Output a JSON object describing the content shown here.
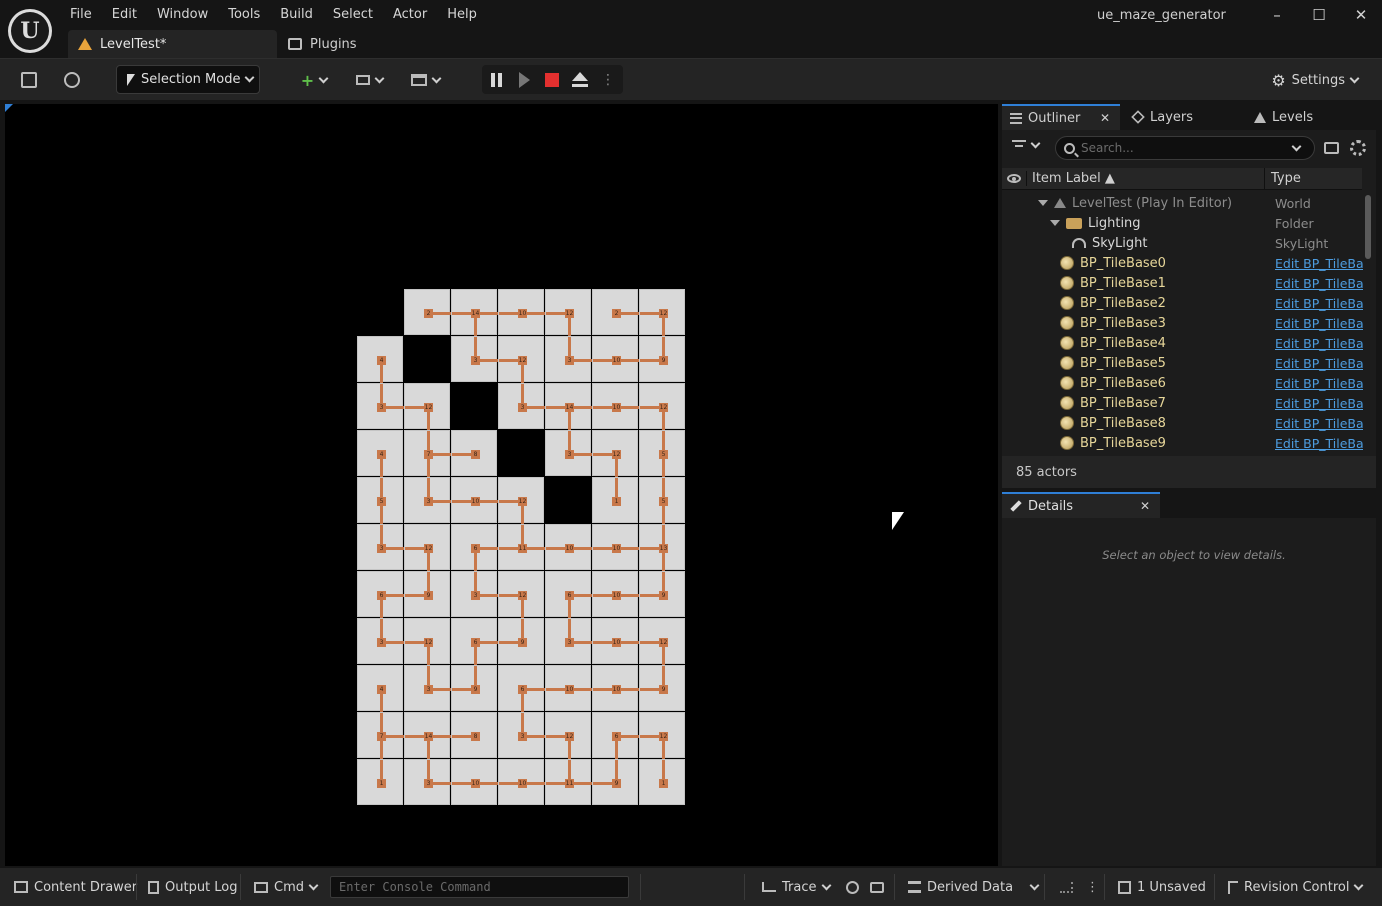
{
  "menu": [
    "File",
    "Edit",
    "Window",
    "Tools",
    "Build",
    "Select",
    "Actor",
    "Help"
  ],
  "app_title": "ue_maze_generator",
  "window_controls": {
    "minimize": "–",
    "maximize": "☐",
    "close": "✕"
  },
  "tabs": {
    "level": "LevelTest*",
    "plugins": "Plugins"
  },
  "toolbar": {
    "selection_mode": "Selection Mode",
    "settings": "Settings"
  },
  "outliner": {
    "tabs": [
      "Outliner",
      "Layers",
      "Levels"
    ],
    "search_placeholder": "Search...",
    "columns": {
      "label": "Item Label ▲",
      "type": "Type"
    },
    "rows": [
      {
        "label": "LevelTest (Play In Editor)",
        "type": "World",
        "kind": "world",
        "indent": 0
      },
      {
        "label": "Lighting",
        "type": "Folder",
        "kind": "folder",
        "indent": 1
      },
      {
        "label": "SkyLight",
        "type": "SkyLight",
        "kind": "sky",
        "indent": 2
      },
      {
        "label": "BP_TileBase0",
        "type": "Edit BP_TileBase",
        "kind": "actor",
        "indent": 0
      },
      {
        "label": "BP_TileBase1",
        "type": "Edit BP_TileBase",
        "kind": "actor",
        "indent": 0
      },
      {
        "label": "BP_TileBase2",
        "type": "Edit BP_TileBase",
        "kind": "actor",
        "indent": 0
      },
      {
        "label": "BP_TileBase3",
        "type": "Edit BP_TileBase",
        "kind": "actor",
        "indent": 0
      },
      {
        "label": "BP_TileBase4",
        "type": "Edit BP_TileBase",
        "kind": "actor",
        "indent": 0
      },
      {
        "label": "BP_TileBase5",
        "type": "Edit BP_TileBase",
        "kind": "actor",
        "indent": 0
      },
      {
        "label": "BP_TileBase6",
        "type": "Edit BP_TileBase",
        "kind": "actor",
        "indent": 0
      },
      {
        "label": "BP_TileBase7",
        "type": "Edit BP_TileBase",
        "kind": "actor",
        "indent": 0
      },
      {
        "label": "BP_TileBase8",
        "type": "Edit BP_TileBase",
        "kind": "actor",
        "indent": 0
      },
      {
        "label": "BP_TileBase9",
        "type": "Edit BP_TileBase",
        "kind": "actor",
        "indent": 0
      }
    ],
    "actor_count": "85 actors"
  },
  "details": {
    "tab": "Details",
    "empty_message": "Select an object to view details."
  },
  "statusbar": {
    "content_drawer": "Content Drawer",
    "output_log": "Output Log",
    "cmd": "Cmd",
    "console_placeholder": "Enter Console Command",
    "trace": "Trace",
    "derived_data": "Derived Data",
    "unsaved": "1 Unsaved",
    "revision_control": "Revision Control"
  },
  "maze": {
    "rows": [
      [
        "-",
        "2",
        "14",
        "10",
        "12",
        "2",
        "12"
      ],
      [
        "4",
        "X",
        "3",
        "12",
        "3",
        "10",
        "9"
      ],
      [
        "3",
        "12",
        "X",
        "3",
        "14",
        "10",
        "12"
      ],
      [
        "4",
        "7",
        "8",
        "X",
        "3",
        "12",
        "5"
      ],
      [
        "5",
        "3",
        "10",
        "12",
        "X",
        "1",
        "5"
      ],
      [
        "3",
        "12",
        "6",
        "11",
        "10",
        "10",
        "13"
      ],
      [
        "6",
        "9",
        "3",
        "12",
        "6",
        "10",
        "9"
      ],
      [
        "3",
        "12",
        "6",
        "9",
        "3",
        "10",
        "12"
      ],
      [
        "4",
        "3",
        "9",
        "6",
        "10",
        "10",
        "9"
      ],
      [
        "7",
        "14",
        "8",
        "3",
        "12",
        "6",
        "12"
      ],
      [
        "1",
        "3",
        "10",
        "10",
        "11",
        "9",
        "1"
      ]
    ]
  },
  "colors": {
    "accent": "#2f7fd6",
    "link": "#4d9de0",
    "pipe": "#c8784a",
    "stop": "#e3302f"
  }
}
